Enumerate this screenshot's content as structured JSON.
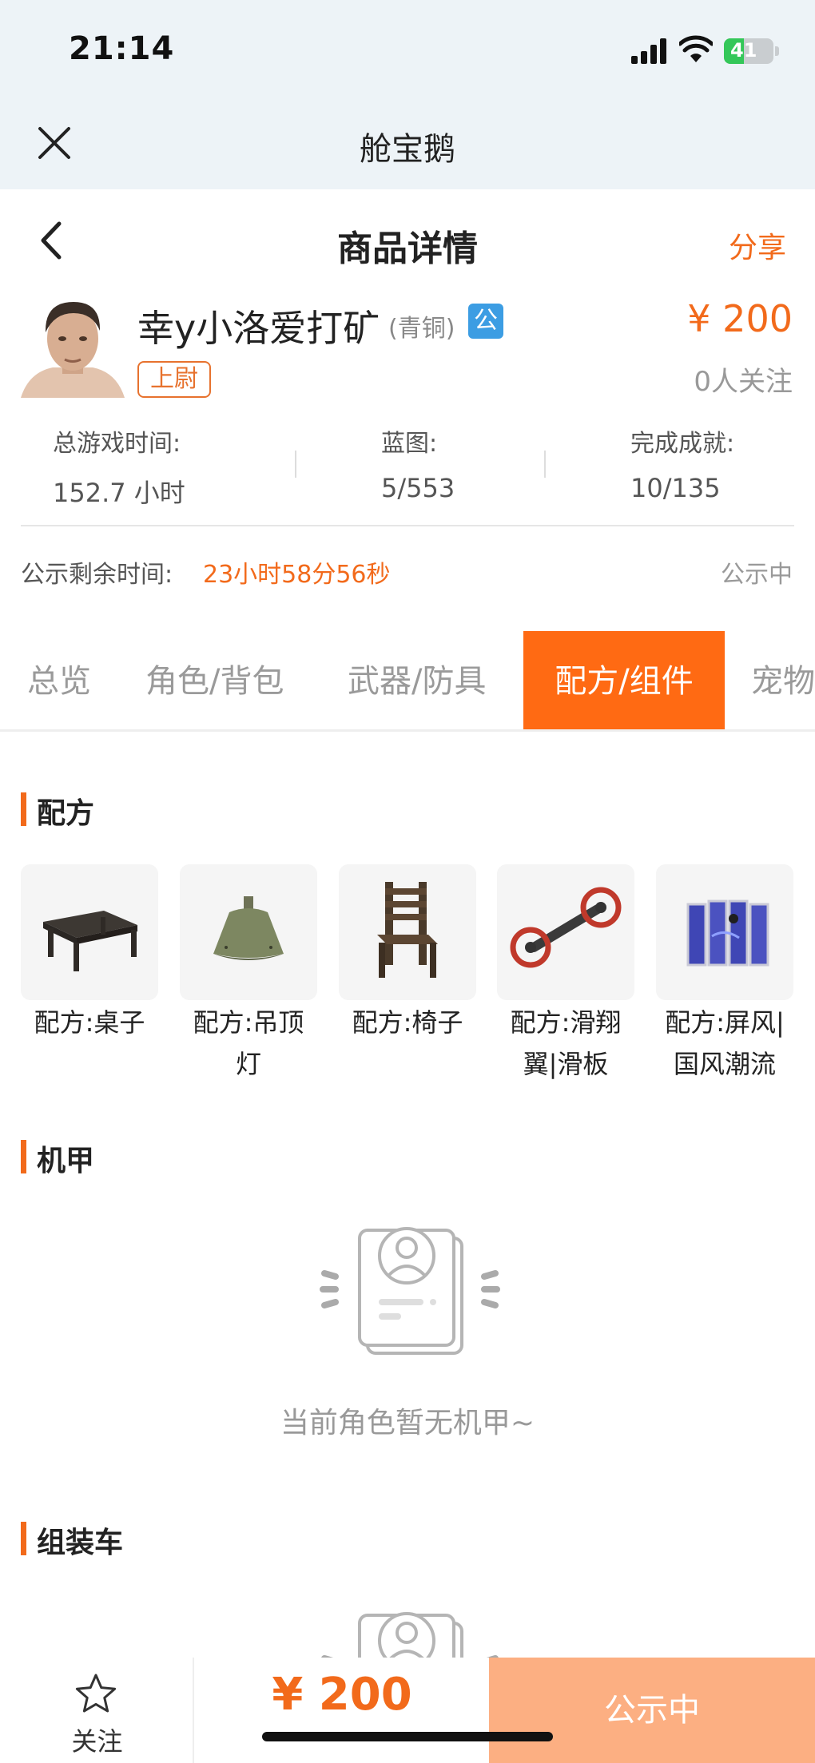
{
  "status_bar": {
    "time": "21:14",
    "battery": "41",
    "battery_level": 0.41
  },
  "app": {
    "title": "舱宝鹅"
  },
  "nav": {
    "title": "商品详情",
    "share": "分享"
  },
  "seller": {
    "name": "幸y小洛爱打矿",
    "tier": "(青铜)",
    "official_badge": "公",
    "rank": "上尉",
    "price": "¥ 200",
    "followers": "0人关注"
  },
  "stats": [
    {
      "label": "总游戏时间:",
      "value": "152.7 小时"
    },
    {
      "label": "蓝图:",
      "value": "5/553"
    },
    {
      "label": "完成成就:",
      "value": "10/135"
    }
  ],
  "notice": {
    "label": "公示剩余时间:",
    "remaining": "23小时58分56秒",
    "status": "公示中"
  },
  "tabs": [
    {
      "label": "总览",
      "active": false
    },
    {
      "label": "角色/背包",
      "active": false
    },
    {
      "label": "武器/防具",
      "active": false
    },
    {
      "label": "配方/组件",
      "active": true
    },
    {
      "label": "宠物",
      "active": false
    }
  ],
  "sections": {
    "recipes": {
      "title": "配方",
      "items": [
        {
          "line1": "配方:桌子",
          "line2": "",
          "icon": "table-icon"
        },
        {
          "line1": "配方:吊顶",
          "line2": "灯",
          "icon": "ceiling-lamp-icon"
        },
        {
          "line1": "配方:椅子",
          "line2": "",
          "icon": "chair-icon"
        },
        {
          "line1": "配方:滑翔",
          "line2": "翼|滑板",
          "icon": "glider-icon"
        },
        {
          "line1": "配方:屏风|",
          "line2": "国风潮流",
          "icon": "folding-screen-icon"
        }
      ]
    },
    "mecha": {
      "title": "机甲",
      "empty_text": "当前角色暂无机甲~"
    },
    "vehicle": {
      "title": "组装车"
    }
  },
  "bottom": {
    "follow": "关注",
    "price": "¥ 200",
    "cta": "公示中"
  },
  "colors": {
    "accent": "#f26a1b",
    "tab_active": "#ff6a13",
    "cta": "#fcaf82",
    "header_bg": "#edf3f7"
  }
}
